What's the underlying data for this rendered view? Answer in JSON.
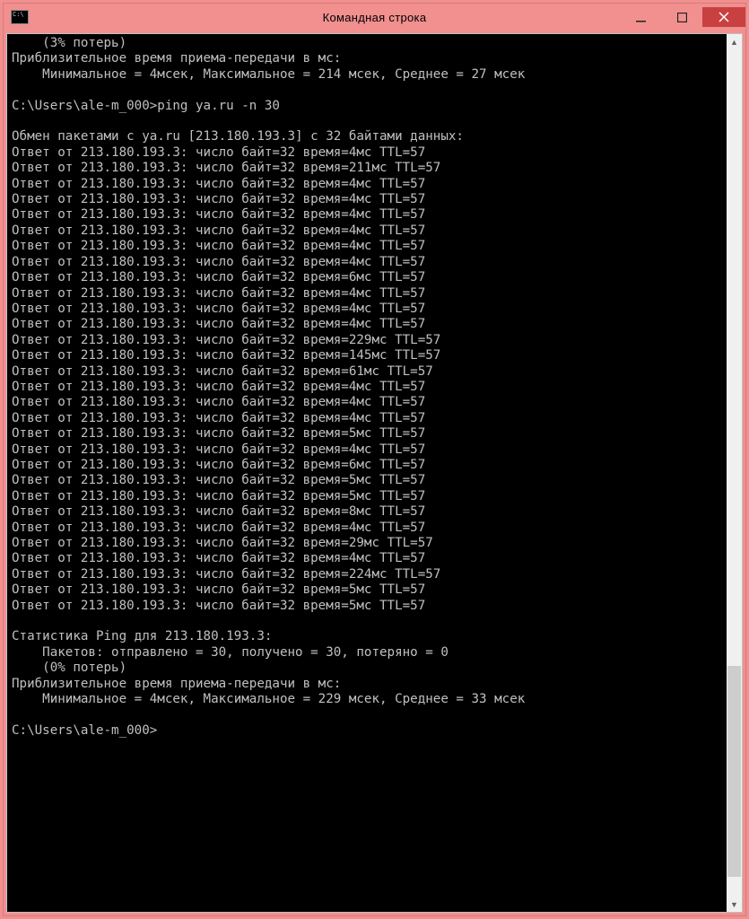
{
  "window": {
    "title": "Командная строка"
  },
  "terminal": {
    "prev_loss": "    (3% потерь)",
    "prev_approx": "Приблизительное время приема-передачи в мс:",
    "prev_times": "    Минимальное = 4мсек, Максимальное = 214 мсек, Среднее = 27 мсек",
    "prompt1": "C:\\Users\\ale-m_000>ping ya.ru -n 30",
    "exchange": "Обмен пакетами с ya.ru [213.180.193.3] с 32 байтами данных:",
    "ip": "213.180.193.3",
    "bytes": 32,
    "ttl": 57,
    "replies": [
      4,
      211,
      4,
      4,
      4,
      4,
      4,
      4,
      6,
      4,
      4,
      4,
      229,
      145,
      61,
      4,
      4,
      4,
      5,
      4,
      6,
      5,
      5,
      8,
      4,
      29,
      4,
      224,
      5,
      5
    ],
    "stats_header": "Статистика Ping для 213.180.193.3:",
    "stats_packets": "    Пакетов: отправлено = 30, получено = 30, потеряно = 0",
    "stats_loss": "    (0% потерь)",
    "approx": "Приблизительное время приема-передачи в мс:",
    "times": "    Минимальное = 4мсек, Максимальное = 229 мсек, Среднее = 33 мсек",
    "prompt2": "C:\\Users\\ale-m_000>"
  }
}
